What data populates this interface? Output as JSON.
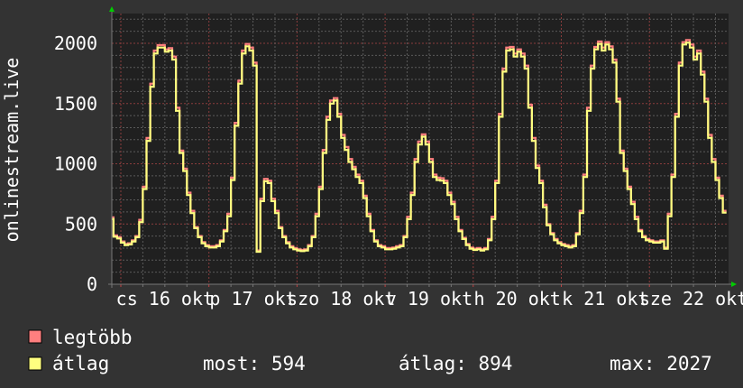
{
  "chart_data": {
    "type": "line",
    "title": "",
    "ylabel": "onlinestream.live",
    "xlabel": "",
    "ylim": [
      0,
      2250
    ],
    "yticks": [
      0,
      500,
      1000,
      1500,
      2000
    ],
    "ytick_labels": [
      "0",
      "500",
      "1000",
      "1500",
      "2000"
    ],
    "grid": true,
    "legend_placement": "bottom-left",
    "x_tick_labels": [
      {
        "day": 16,
        "label": "cs 16 okt"
      },
      {
        "day": 17,
        "label": "p 17 okt"
      },
      {
        "day": 18,
        "label": "szo 18 okt"
      },
      {
        "day": 19,
        "label": "v 19 okt"
      },
      {
        "day": 20,
        "label": "h 20 okt"
      },
      {
        "day": 21,
        "label": "k 21 okt"
      },
      {
        "day": 22,
        "label": "sze 22 okt"
      }
    ],
    "series": [
      {
        "name": "legtöbb",
        "key": "max",
        "color": "#ff7f7f"
      },
      {
        "name": "átlag",
        "key": "avg",
        "color": "#ffff80"
      }
    ],
    "days": [
      {
        "day": 15,
        "start_hour": 22,
        "avg": [
          540,
          395
        ],
        "max": [
          555,
          405
        ]
      },
      {
        "day": 16,
        "start_hour": 0,
        "avg": [
          380,
          345,
          325,
          330,
          355,
          390,
          515,
          790,
          1190,
          1640,
          1915,
          1965,
          1965,
          1930,
          1940,
          1865,
          1440,
          1090,
          940,
          740,
          590,
          465,
          390,
          340
        ],
        "max": [
          390,
          355,
          335,
          340,
          365,
          400,
          535,
          810,
          1215,
          1665,
          1940,
          1985,
          1985,
          1950,
          1960,
          1890,
          1465,
          1110,
          960,
          760,
          610,
          475,
          400,
          350
        ]
      },
      {
        "day": 17,
        "start_hour": 0,
        "avg": [
          315,
          305,
          305,
          315,
          355,
          440,
          565,
          865,
          1315,
          1665,
          1915,
          1975,
          1940,
          1815,
          270,
          690,
          855,
          840,
          690,
          590,
          465,
          390,
          340,
          305
        ],
        "max": [
          325,
          315,
          315,
          325,
          365,
          450,
          585,
          885,
          1340,
          1690,
          1940,
          1995,
          1965,
          1840,
          280,
          710,
          875,
          860,
          710,
          610,
          475,
          400,
          350,
          315
        ]
      },
      {
        "day": 18,
        "start_hour": 0,
        "avg": [
          290,
          280,
          275,
          280,
          315,
          390,
          565,
          790,
          1090,
          1365,
          1500,
          1525,
          1390,
          1215,
          1115,
          1015,
          955,
          890,
          840,
          715,
          565,
          440,
          355,
          315
        ],
        "max": [
          300,
          290,
          285,
          290,
          325,
          400,
          585,
          810,
          1115,
          1390,
          1525,
          1545,
          1415,
          1240,
          1140,
          1040,
          975,
          910,
          860,
          735,
          585,
          450,
          365,
          325
        ]
      },
      {
        "day": 19,
        "start_hour": 0,
        "avg": [
          305,
          290,
          290,
          295,
          305,
          315,
          390,
          540,
          740,
          1015,
          1160,
          1225,
          1160,
          1015,
          890,
          865,
          860,
          840,
          740,
          665,
          540,
          440,
          375,
          325
        ],
        "max": [
          315,
          300,
          300,
          305,
          315,
          325,
          400,
          560,
          760,
          1040,
          1185,
          1245,
          1185,
          1040,
          910,
          885,
          880,
          860,
          760,
          685,
          560,
          450,
          385,
          335
        ]
      },
      {
        "day": 20,
        "start_hour": 0,
        "avg": [
          295,
          285,
          290,
          280,
          290,
          365,
          540,
          840,
          1390,
          1765,
          1940,
          1950,
          1890,
          1930,
          1890,
          1790,
          1465,
          1190,
          965,
          840,
          640,
          490,
          415,
          365
        ],
        "max": [
          305,
          295,
          300,
          290,
          300,
          375,
          560,
          860,
          1415,
          1790,
          1965,
          1970,
          1915,
          1950,
          1915,
          1815,
          1490,
          1215,
          985,
          860,
          660,
          500,
          425,
          375
        ]
      },
      {
        "day": 21,
        "start_hour": 0,
        "avg": [
          340,
          325,
          315,
          305,
          315,
          415,
          590,
          890,
          1440,
          1790,
          1950,
          1995,
          1940,
          1990,
          1950,
          1840,
          1515,
          1090,
          940,
          790,
          665,
          540,
          440,
          390
        ],
        "max": [
          350,
          335,
          325,
          315,
          325,
          425,
          610,
          910,
          1465,
          1815,
          1970,
          2015,
          1965,
          2010,
          1975,
          1865,
          1540,
          1110,
          960,
          810,
          685,
          560,
          450,
          400
        ]
      },
      {
        "day": 22,
        "start_hour": 0,
        "avg": [
          365,
          355,
          345,
          345,
          355,
          295,
          565,
          890,
          1390,
          1815,
          1990,
          2005,
          1965,
          1865,
          1915,
          1740,
          1515,
          1215,
          1015,
          865,
          715,
          594
        ],
        "max": [
          375,
          365,
          355,
          355,
          365,
          305,
          585,
          910,
          1415,
          1840,
          2010,
          2027,
          1990,
          1890,
          1940,
          1765,
          1540,
          1240,
          1040,
          885,
          735,
          610
        ]
      }
    ]
  },
  "legend": {
    "items": [
      {
        "label": "legtöbb",
        "color": "#ff7f7f"
      },
      {
        "label": "átlag",
        "color": "#ffff80"
      }
    ],
    "stats": {
      "current": "most: 594",
      "average": "átlag: 894",
      "maximum": "max: 2027"
    }
  },
  "colors": {
    "background": "#333333",
    "plot_background": "#202020",
    "grid_minor": "#5a5a5a",
    "grid_major": "#8a3c3c",
    "arrow": "#00cc00"
  }
}
